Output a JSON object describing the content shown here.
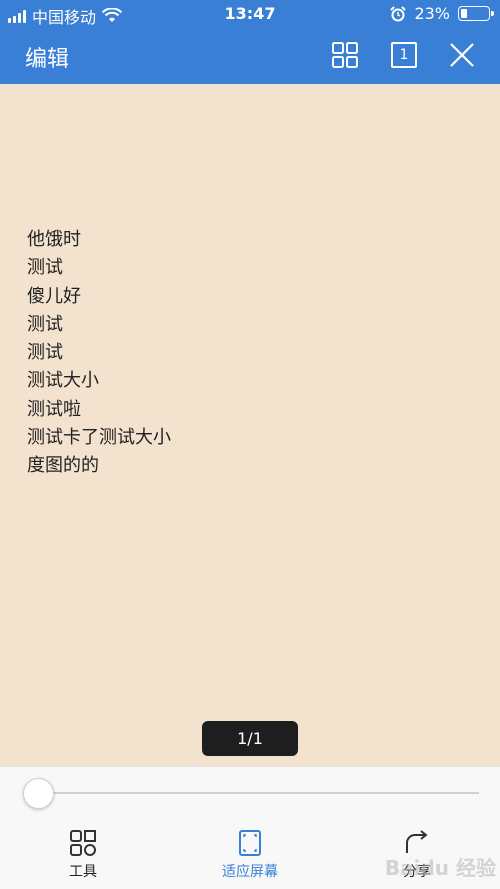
{
  "status_bar": {
    "carrier": "中国移动",
    "time": "13:47",
    "battery": "23%",
    "battery_level": 0.23
  },
  "header": {
    "title": "编辑",
    "page_icon_label": "1"
  },
  "document": {
    "lines": [
      "他饿时",
      "测试",
      "傻儿好",
      "测试",
      "测试",
      "测试大小",
      "测试啦",
      "测试卡了测试大小",
      "度图的的"
    ]
  },
  "page_indicator": "1/1",
  "slider": {
    "value": 0
  },
  "toolbar": {
    "tools_label": "工具",
    "fit_screen_label": "适应屏幕",
    "share_label": "分享"
  },
  "watermark": "Baidu 经验",
  "colors": {
    "accent": "#3a7fd6",
    "page_background": "#f3e2cd"
  }
}
